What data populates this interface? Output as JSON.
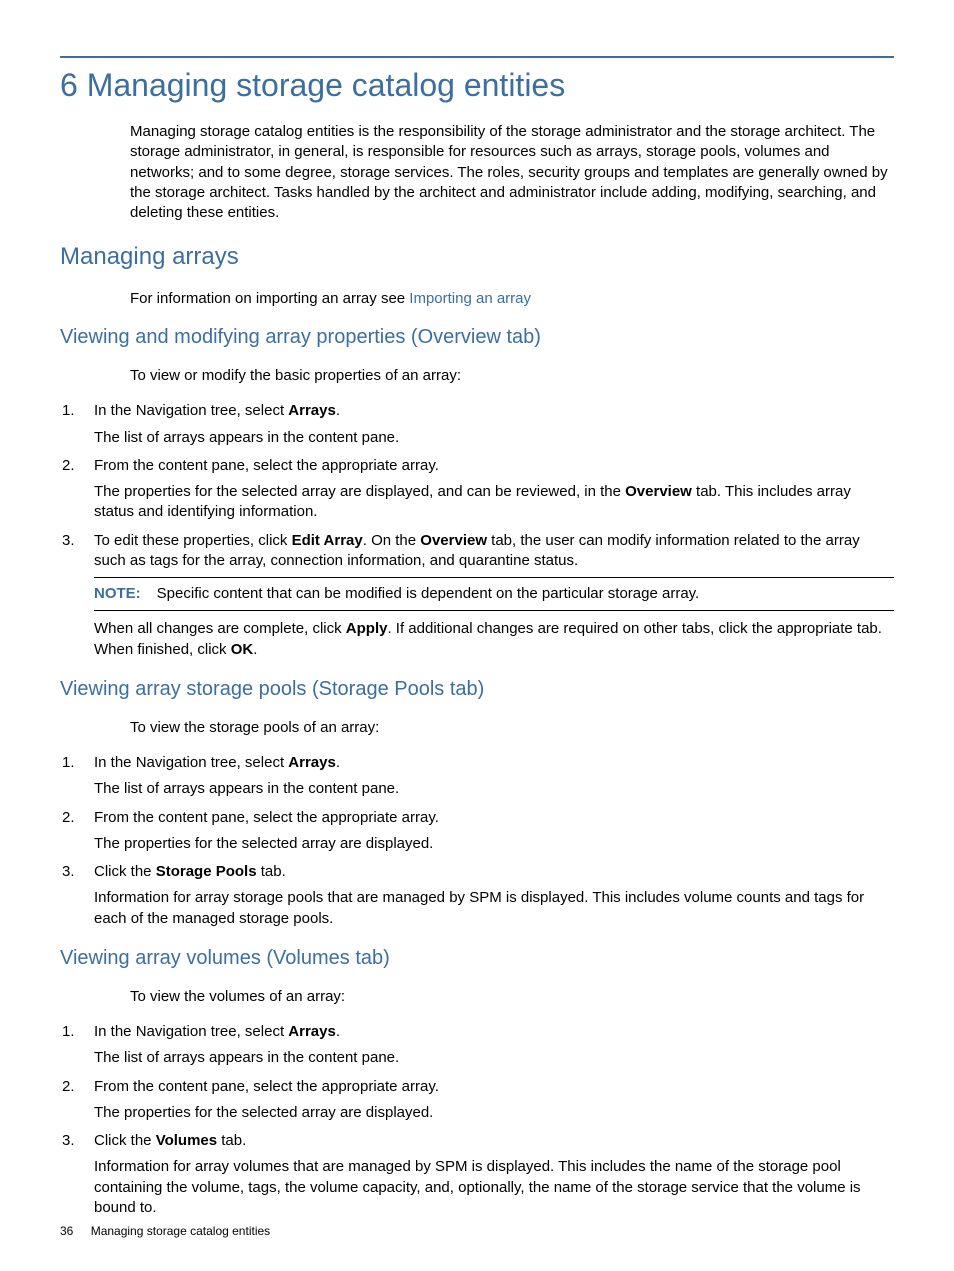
{
  "chapter": {
    "number": "6",
    "title": "Managing storage catalog entities",
    "intro": "Managing storage catalog entities is the responsibility of the storage administrator and the storage architect. The storage administrator, in general, is responsible for resources such as arrays, storage pools, volumes and networks; and to some degree, storage services. The roles, security groups and templates are generally owned by the storage architect. Tasks handled by the architect and administrator include adding, modifying, searching, and deleting these entities."
  },
  "managing_arrays": {
    "heading": "Managing arrays",
    "text_before_link": "For information on importing an array see ",
    "link_text": "Importing an array"
  },
  "overview_tab": {
    "heading": "Viewing and modifying array properties (Overview tab)",
    "lead": "To view or modify the basic properties of an array:",
    "steps": [
      {
        "num": "1.",
        "line1_a": "In the Navigation tree, select ",
        "line1_bold": "Arrays",
        "line1_b": ".",
        "line2": "The list of arrays appears in the content pane."
      },
      {
        "num": "2.",
        "line1": "From the content pane, select the appropriate array.",
        "line2_a": "The properties for the selected array are displayed, and can be reviewed, in the ",
        "line2_bold": "Overview",
        "line2_b": " tab. This includes array status and identifying information."
      },
      {
        "num": "3.",
        "line1_a": "To edit these properties, click ",
        "line1_bold1": "Edit Array",
        "line1_b": ". On the ",
        "line1_bold2": "Overview",
        "line1_c": " tab, the user can modify information related to the array such as tags for the array, connection information, and quarantine status.",
        "note_label": "NOTE:",
        "note_text": "Specific content that can be modified is dependent on the particular storage array.",
        "line3_a": "When all changes are complete, click ",
        "line3_bold1": "Apply",
        "line3_b": ". If additional changes are required on other tabs, click the appropriate tab. When finished, click ",
        "line3_bold2": "OK",
        "line3_c": "."
      }
    ]
  },
  "storage_pools_tab": {
    "heading": "Viewing array storage pools (Storage Pools tab)",
    "lead": "To view the storage pools of an array:",
    "steps": [
      {
        "num": "1.",
        "line1_a": "In the Navigation tree, select ",
        "line1_bold": "Arrays",
        "line1_b": ".",
        "line2": "The list of arrays appears in the content pane."
      },
      {
        "num": "2.",
        "line1": "From the content pane, select the appropriate array.",
        "line2": "The properties for the selected array are displayed."
      },
      {
        "num": "3.",
        "line1_a": "Click the ",
        "line1_bold": "Storage Pools",
        "line1_b": " tab.",
        "line2": "Information for array storage pools that are managed by SPM is displayed. This includes volume counts and tags for each of the managed storage pools."
      }
    ]
  },
  "volumes_tab": {
    "heading": "Viewing array volumes (Volumes tab)",
    "lead": "To view the volumes of an array:",
    "steps": [
      {
        "num": "1.",
        "line1_a": "In the Navigation tree, select ",
        "line1_bold": "Arrays",
        "line1_b": ".",
        "line2": "The list of arrays appears in the content pane."
      },
      {
        "num": "2.",
        "line1": "From the content pane, select the appropriate array.",
        "line2": "The properties for the selected array are displayed."
      },
      {
        "num": "3.",
        "line1_a": "Click the ",
        "line1_bold": "Volumes",
        "line1_b": " tab.",
        "line2": "Information for array volumes that are managed by SPM is displayed. This includes the name of the storage pool containing the volume, tags, the volume capacity, and, optionally, the name of the storage service that the volume is bound to."
      }
    ]
  },
  "footer": {
    "page": "36",
    "title": "Managing storage catalog entities"
  }
}
